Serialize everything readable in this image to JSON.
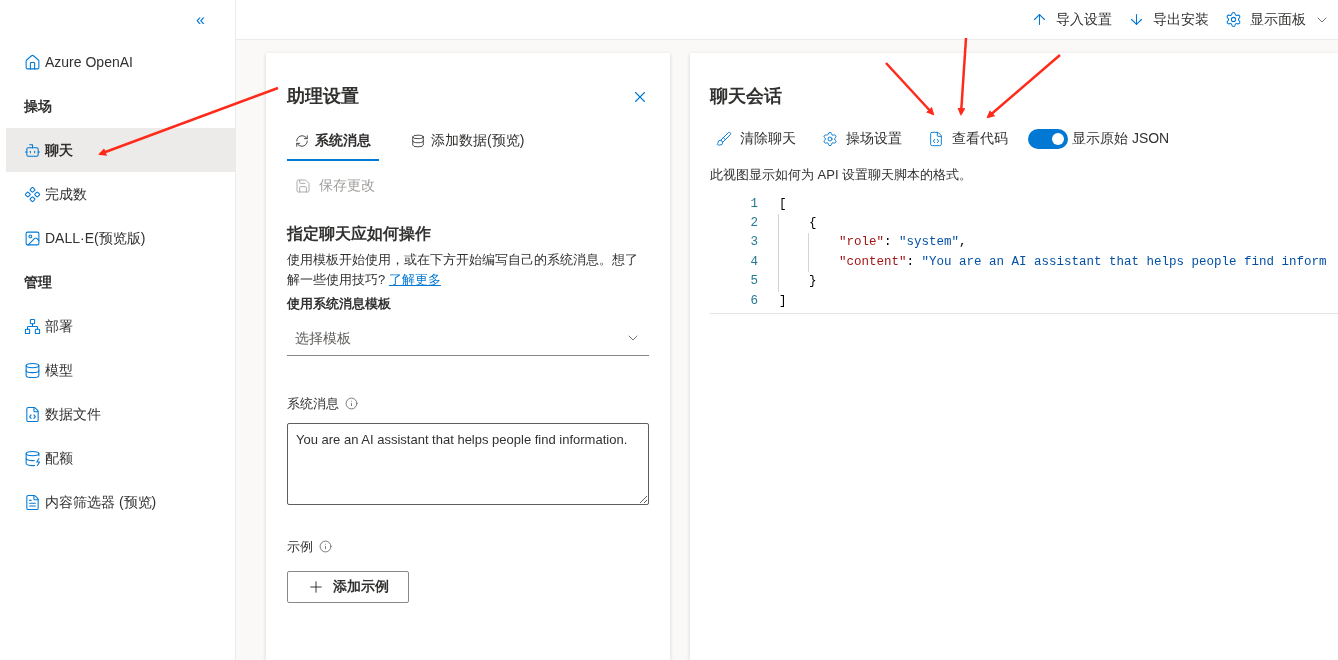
{
  "sidebar": {
    "collapse": "«",
    "items": [
      {
        "kind": "link",
        "label": "Azure OpenAI",
        "selected": false
      },
      {
        "kind": "section",
        "label": "操场"
      },
      {
        "kind": "link",
        "label": "聊天",
        "selected": true
      },
      {
        "kind": "link",
        "label": "完成数",
        "selected": false
      },
      {
        "kind": "link",
        "label": "DALL·E(预览版)",
        "selected": false
      },
      {
        "kind": "section",
        "label": "管理"
      },
      {
        "kind": "link",
        "label": "部署",
        "selected": false
      },
      {
        "kind": "link",
        "label": "模型",
        "selected": false
      },
      {
        "kind": "link",
        "label": "数据文件",
        "selected": false
      },
      {
        "kind": "link",
        "label": "配额",
        "selected": false
      },
      {
        "kind": "link",
        "label": "内容筛选器 (预览)",
        "selected": false
      }
    ]
  },
  "toolbar": [
    "导入设置",
    "导出安装",
    "显示面板"
  ],
  "assistant": {
    "title": "助理设置",
    "tabs": [
      {
        "label": "系统消息",
        "selected": true
      },
      {
        "label": "添加数据(预览)",
        "selected": false
      }
    ],
    "save": {
      "label": "保存更改",
      "disabled": true
    },
    "heading": "指定聊天应如何操作",
    "description": "使用模板开始使用，或在下方开始编写自己的系统消息。想了解一些使用技巧?",
    "learn_more": "了解更多",
    "template_label": "使用系统消息模板",
    "template_placeholder": "选择模板",
    "system_label": "系统消息",
    "system_value": "You are an AI assistant that helps people find information.",
    "examples_label": "示例",
    "add_example": "添加示例"
  },
  "chat": {
    "title": "聊天会话",
    "actions": [
      "清除聊天",
      "操场设置",
      "查看代码"
    ],
    "toggle": {
      "label": "显示原始 JSON",
      "on": true
    },
    "note": "此视图显示如何为 API 设置聊天脚本的格式。",
    "code": [
      {
        "number": "1",
        "tokens": [
          {
            "kind": "punct",
            "text": "["
          }
        ]
      },
      {
        "number": "2",
        "tokens": [
          {
            "kind": "punct",
            "text": "{"
          }
        ]
      },
      {
        "number": "3",
        "tokens": [
          {
            "kind": "key",
            "text": "\"role\""
          },
          {
            "kind": "punct",
            "text": ": "
          },
          {
            "kind": "string",
            "text": "\"system\""
          },
          {
            "kind": "punct",
            "text": ","
          }
        ]
      },
      {
        "number": "4",
        "tokens": [
          {
            "kind": "key",
            "text": "\"content\""
          },
          {
            "kind": "punct",
            "text": ": "
          },
          {
            "kind": "string",
            "text": "\"You are an AI assistant that helps people find inform"
          }
        ]
      },
      {
        "number": "5",
        "tokens": [
          {
            "kind": "punct",
            "text": "}"
          }
        ]
      },
      {
        "number": "6",
        "tokens": [
          {
            "kind": "punct",
            "text": "]"
          }
        ]
      }
    ]
  }
}
